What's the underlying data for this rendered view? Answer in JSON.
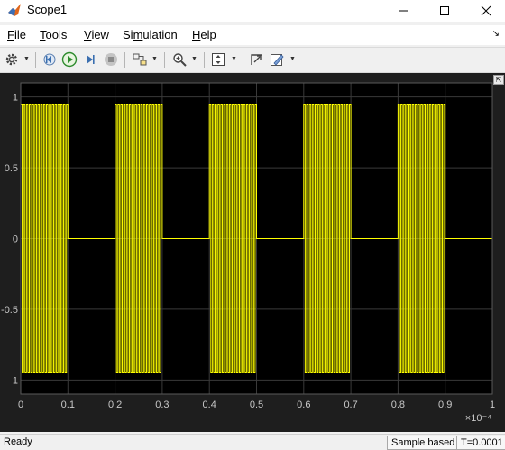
{
  "window": {
    "title": "Scope1"
  },
  "menu": [
    {
      "label": "File"
    },
    {
      "label": "Tools"
    },
    {
      "label": "View"
    },
    {
      "label": "Simulation"
    },
    {
      "label": "Help"
    }
  ],
  "toolbar": {
    "icons": [
      "gear-icon",
      "step-back-icon",
      "run-icon",
      "step-forward-icon",
      "stop-icon",
      "highlight-block-icon",
      "zoom-icon",
      "autoscale-icon",
      "cursor-measure-icon",
      "style-icon"
    ]
  },
  "status": {
    "left": "Ready",
    "mode": "Sample based",
    "time": "T=0.0001"
  },
  "colors": {
    "plot_background": "#000000",
    "figure_background": "#1e1e1e",
    "grid": "#3a3a3a",
    "signal": "#ffff00",
    "tick_text": "#c8c8c8"
  },
  "chart_data": {
    "type": "line",
    "title": "",
    "xlabel": "",
    "ylabel": "",
    "xlim": [
      0,
      1
    ],
    "ylim": [
      -1.1,
      1.1
    ],
    "x_exponent": "×10⁻⁴",
    "x_ticks": [
      "0",
      "0.1",
      "0.2",
      "0.3",
      "0.4",
      "0.5",
      "0.6",
      "0.7",
      "0.8",
      "0.9",
      "1"
    ],
    "y_ticks": [
      "1",
      "0.5",
      "0",
      "-0.5",
      "-1"
    ],
    "grid": true,
    "series": [
      {
        "description": "high-frequency square bursts between -0.95 and 0.95, zero between bursts",
        "amplitude": 0.95,
        "bursts": [
          [
            0.0,
            0.1
          ],
          [
            0.2,
            0.3
          ],
          [
            0.4,
            0.5
          ],
          [
            0.6,
            0.7
          ],
          [
            0.8,
            0.9
          ]
        ],
        "values_between_bursts": 0
      }
    ]
  }
}
